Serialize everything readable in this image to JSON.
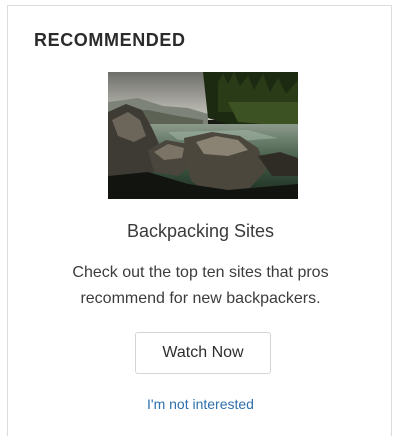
{
  "card": {
    "heading": "RECOMMENDED",
    "image_subject": "river-landscape-photo",
    "item_title": "Backpacking Sites",
    "description": "Check out the top ten sites that pros recommend for new backpackers.",
    "primary_button_label": "Watch Now",
    "dismiss_link_label": "I'm not interested"
  },
  "colors": {
    "heading": "#2b2b2b",
    "body_text": "#3c3c3c",
    "link": "#2f6fad",
    "button_border": "#d5d5d5",
    "card_border": "#dcdcdc"
  }
}
